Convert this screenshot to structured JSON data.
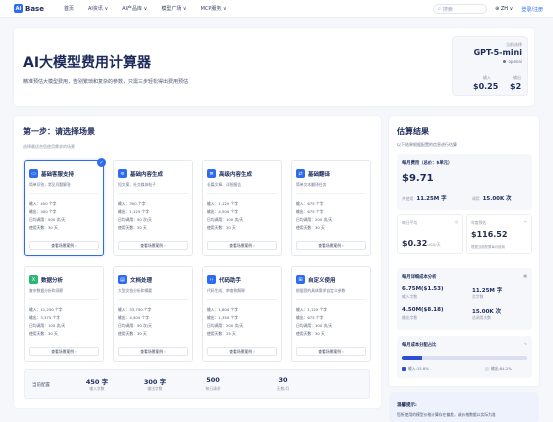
{
  "nav": {
    "logo_mark": "AI",
    "logo_text": "Base",
    "links": [
      "首页",
      "AI资讯 ∨",
      "AI产品库 ∨",
      "模型广场 ∨",
      "MCP服务 ∨"
    ],
    "search_placeholder": "搜索",
    "lang": "ZH ∨",
    "login": "登录/注册"
  },
  "hero": {
    "title": "AI大模型费用计算器",
    "subtitle": "精准预估大模型费用，告别繁琐和复杂的参数，只需三步轻松得出费用预估",
    "model_label": "当前选择",
    "model_name": "GPT-5-mini",
    "provider": "openai",
    "input_label": "输入",
    "output_label": "输出",
    "input_price": "$0.25",
    "output_price": "$2"
  },
  "step1": {
    "title": "第一步：请选择场景",
    "hint": "选择最适合您使用需求的场景",
    "scenarios": [
      {
        "title": "基础客服支持",
        "desc": "简单问答，常见问题解答",
        "icon": "monitor-icon",
        "color": "#2d6cf0",
        "glyph": "▭",
        "stats": [
          "输入：450 个字",
          "输出：300 个字",
          "日均调用：500 次/天",
          "使用天数：30 天"
        ],
        "btn": "查看场景案例 ›",
        "selected": true
      },
      {
        "title": "基础内容生成",
        "desc": "短文案、社交媒体帖子",
        "icon": "document-icon",
        "color": "#2d6cf0",
        "glyph": "≡",
        "stats": [
          "输入：300 个字",
          "输出：1,125 个字",
          "日均调用：50 次/天",
          "使用天数：30 天"
        ],
        "btn": "查看场景案例 ›",
        "selected": false
      },
      {
        "title": "高级内容生成",
        "desc": "长篇文章、详细报告",
        "icon": "report-icon",
        "color": "#2d6cf0",
        "glyph": "≣",
        "stats": [
          "输入：1,125 个字",
          "输出：4,500 个字",
          "日均调用：100 次/天",
          "使用天数：30 天"
        ],
        "btn": "查看场景案例 ›",
        "selected": false
      },
      {
        "title": "基础翻译",
        "desc": "简单文本翻译任务",
        "icon": "translate-icon",
        "color": "#2d6cf0",
        "glyph": "⇄",
        "stats": [
          "输入：675 个字",
          "输出：675 个字",
          "日均调用：200 次/天",
          "使用天数：30 天"
        ],
        "btn": "查看场景案例 ›",
        "selected": false
      },
      {
        "title": "数据分析",
        "desc": "复杂数据分析和洞察",
        "icon": "spreadsheet-icon",
        "color": "#2bb673",
        "glyph": "X",
        "stats": [
          "输入：11,250 个字",
          "输出：3,375 个字",
          "日均调用：100 次/天",
          "使用天数：30 天"
        ],
        "btn": "查看场景案例 ›",
        "selected": false
      },
      {
        "title": "文档处理",
        "desc": "大型文档分析和摘要",
        "icon": "file-icon",
        "color": "#2d6cf0",
        "glyph": "▤",
        "stats": [
          "输入：33,750 个字",
          "输出：4,500 个字",
          "日均调用：50 次/天",
          "使用天数：30 天"
        ],
        "btn": "查看场景案例 ›",
        "selected": false
      },
      {
        "title": "代码助手",
        "desc": "代码生成、审查和解释",
        "icon": "code-icon",
        "color": "#2d6cf0",
        "glyph": "‹›",
        "stats": [
          "输入：1,800 个字",
          "输出：1,350 个字",
          "日均调用：200 次/天",
          "使用天数：25 天"
        ],
        "btn": "查看场景案例 ›",
        "selected": false
      },
      {
        "title": "自定义使用",
        "desc": "根据您的具体需求自定义参数",
        "icon": "grid-icon",
        "color": "#2d6cf0",
        "glyph": "⊞",
        "stats": [
          "输入：1,125 个字",
          "输出：675 个字",
          "日均调用：100 次/天",
          "使用天数：30 天"
        ],
        "btn": "查看场景案例 ›",
        "selected": false
      }
    ],
    "current": {
      "label": "当前配置",
      "items": [
        {
          "value": "450 字",
          "sub": "输入字数"
        },
        {
          "value": "300 字",
          "sub": "输出字数"
        },
        {
          "value": "500",
          "sub": "每日请求"
        },
        {
          "value": "30",
          "sub": "天数/月"
        }
      ]
    }
  },
  "results": {
    "title": "估算结果",
    "hint": "以下结果根据配置的信息进行估算",
    "monthly_title": "每月费用（总价：$单元）",
    "monthly_value": "$9.71",
    "token_label": "共使用",
    "token_value": "11.25M 字",
    "calls_label": "调用",
    "calls_value": "15.00K 次",
    "daily_label": "每日平均",
    "daily_value": "$0.32",
    "daily_unit": "USD/天",
    "year_label": "年度预估",
    "year_value": "$116.52",
    "year_note": "根据当前配置每月使用",
    "detail_title": "每月详细成本分析",
    "details": [
      {
        "value": "6.75M($1.53)",
        "sub": "输入字数"
      },
      {
        "value": "11.25M 字",
        "sub": "总字数"
      },
      {
        "value": "4.50M($8.18)",
        "sub": "输出字数"
      },
      {
        "value": "15.00K 次",
        "sub": "总调用次数"
      }
    ],
    "dist_title": "每月成本分配占比",
    "input_share": 0.158,
    "input_legend": "输入:15.8%",
    "output_legend": "输出:84.2%",
    "input_color": "#2d4fd6",
    "output_color": "#d9def0"
  },
  "tip": {
    "title": "温馨提示:",
    "text": "您所使用的模型价格计算存在偏差，或价格数据以实际为准"
  }
}
